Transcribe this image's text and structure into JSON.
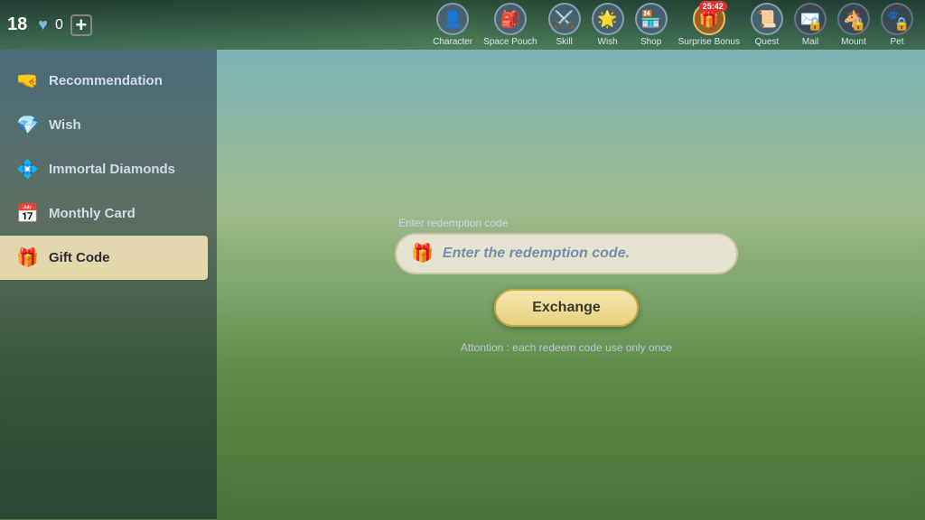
{
  "hud": {
    "level": "18",
    "hearts": "♥",
    "heart_count": "0",
    "plus_label": "+",
    "icons": [
      {
        "id": "character",
        "emoji": "👤",
        "label": "Character",
        "locked": false,
        "badge": null
      },
      {
        "id": "space-pouch",
        "emoji": "🎒",
        "label": "Space Pouch",
        "locked": false,
        "badge": null
      },
      {
        "id": "skill",
        "emoji": "⚔️",
        "label": "Skill",
        "locked": false,
        "badge": null
      },
      {
        "id": "wish",
        "emoji": "🌟",
        "label": "Wish",
        "locked": false,
        "badge": null
      },
      {
        "id": "shop",
        "emoji": "🏪",
        "label": "Shop",
        "locked": false,
        "badge": null
      },
      {
        "id": "surprise-bonus",
        "emoji": "🎁",
        "label": "Surprise Bonus",
        "locked": false,
        "badge": "25:42",
        "highlight": true
      },
      {
        "id": "quest",
        "emoji": "📜",
        "label": "Quest",
        "locked": false,
        "badge": null
      },
      {
        "id": "mail",
        "emoji": "✉️",
        "label": "Mail",
        "locked": true,
        "badge": null
      },
      {
        "id": "mount",
        "emoji": "🐴",
        "label": "Mount",
        "locked": true,
        "badge": null
      },
      {
        "id": "pet",
        "emoji": "🐾",
        "label": "Pet",
        "locked": true,
        "badge": null
      }
    ]
  },
  "sidebar": {
    "items": [
      {
        "id": "recommendation",
        "icon": "🤜",
        "label": "Recommendation",
        "active": false
      },
      {
        "id": "wish",
        "icon": "💎",
        "label": "Wish",
        "active": false
      },
      {
        "id": "immortal-diamonds",
        "icon": "💠",
        "label": "Immortal Diamonds",
        "active": false
      },
      {
        "id": "monthly-card",
        "icon": "📅",
        "label": "Monthly Card",
        "active": false
      },
      {
        "id": "gift-code",
        "icon": "🎁",
        "label": "Gift Code",
        "active": true
      }
    ]
  },
  "gift_code": {
    "input_label": "Enter redemption code",
    "input_placeholder": "Enter the redemption code.",
    "exchange_button": "Exchange",
    "attention_text": "Attontion : each redeem code use only once"
  }
}
